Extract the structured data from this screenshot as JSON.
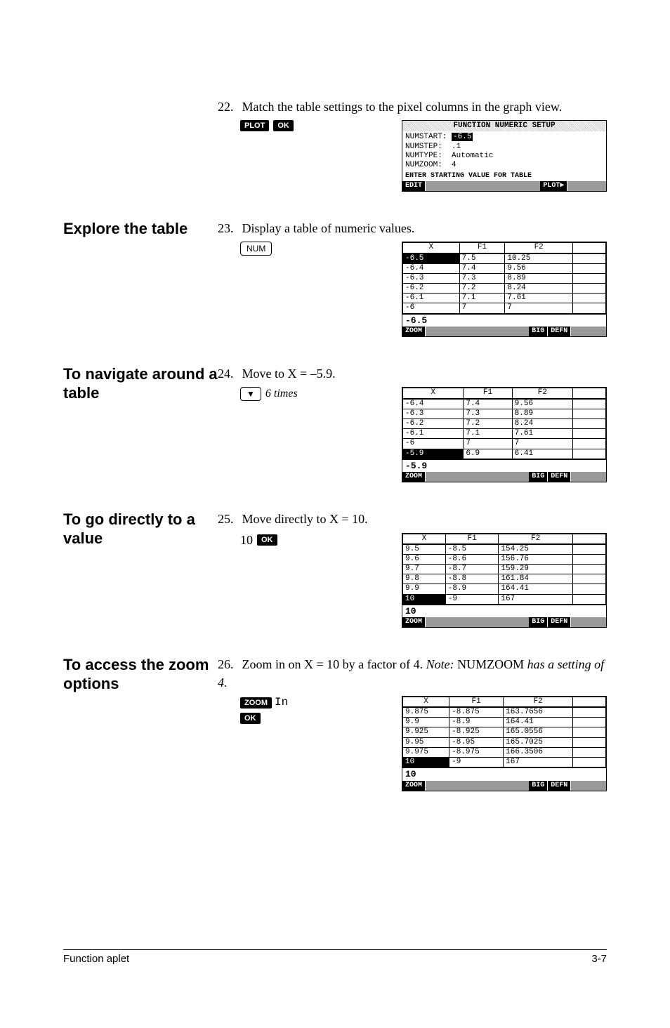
{
  "step22": {
    "num": "22.",
    "text": "Match the table settings to the pixel columns in the graph view.",
    "keys": {
      "plot": "PLOT",
      "ok": "OK"
    }
  },
  "setup_screen": {
    "title": "FUNCTION NUMERIC SETUP",
    "numstart": {
      "label": "NUMSTART:",
      "value": "-6.5"
    },
    "numstep": {
      "label": "NUMSTEP:",
      "value": ".1"
    },
    "numtype": {
      "label": "NUMTYPE:",
      "value": "Automatic"
    },
    "numzoom": {
      "label": "NUMZOOM:",
      "value": "4"
    },
    "prompt": "ENTER STARTING VALUE FOR TABLE",
    "foot": [
      "EDIT",
      "",
      "",
      "",
      "PLOT▶",
      ""
    ]
  },
  "explore": {
    "heading": "Explore the table",
    "num": "23.",
    "text": "Display a table of numeric values.",
    "key": "NUM"
  },
  "table23": {
    "head": [
      "X",
      "F1",
      "F2"
    ],
    "rows": [
      [
        "-6.5",
        "7.5",
        "10.25"
      ],
      [
        "-6.4",
        "7.4",
        "9.56"
      ],
      [
        "-6.3",
        "7.3",
        "8.89"
      ],
      [
        "-6.2",
        "7.2",
        "8.24"
      ],
      [
        "-6.1",
        "7.1",
        "7.61"
      ],
      [
        "-6",
        "7",
        "7"
      ]
    ],
    "sel_row": 0,
    "input": "-6.5",
    "foot": [
      "ZOOM",
      "",
      "",
      "BIG",
      "DEFN",
      ""
    ]
  },
  "navigate": {
    "heading": "To navigate around a table",
    "num": "24.",
    "text": "Move to X = –5.9.",
    "key": "▼",
    "times": "6 times"
  },
  "table24": {
    "head": [
      "X",
      "F1",
      "F2"
    ],
    "rows": [
      [
        "-6.4",
        "7.4",
        "9.56"
      ],
      [
        "-6.3",
        "7.3",
        "8.89"
      ],
      [
        "-6.2",
        "7.2",
        "8.24"
      ],
      [
        "-6.1",
        "7.1",
        "7.61"
      ],
      [
        "-6",
        "7",
        "7"
      ],
      [
        "-5.9",
        "6.9",
        "6.41"
      ]
    ],
    "sel_row": 5,
    "input": "-5.9",
    "foot": [
      "ZOOM",
      "",
      "",
      "BIG",
      "DEFN",
      ""
    ]
  },
  "direct": {
    "heading": "To go directly to a value",
    "num": "25.",
    "text": "Move directly to X = 10.",
    "entry": "10",
    "ok": "OK"
  },
  "table25": {
    "head": [
      "X",
      "F1",
      "F2"
    ],
    "rows": [
      [
        "9.5",
        "-8.5",
        "154.25"
      ],
      [
        "9.6",
        "-8.6",
        "156.76"
      ],
      [
        "9.7",
        "-8.7",
        "159.29"
      ],
      [
        "9.8",
        "-8.8",
        "161.84"
      ],
      [
        "9.9",
        "-8.9",
        "164.41"
      ],
      [
        "10",
        "-9",
        "167"
      ]
    ],
    "sel_row": 5,
    "input": "10",
    "foot": [
      "ZOOM",
      "",
      "",
      "BIG",
      "DEFN",
      ""
    ]
  },
  "zoom": {
    "heading": "To access the zoom options",
    "num": "26.",
    "text_a": "Zoom in on X = 10 by a factor of 4. ",
    "note_label": "Note:",
    "note_text": " NUMZOOM ",
    "note_tail": "has a setting of 4.",
    "zoom_key": "ZOOM",
    "in_text": "In",
    "ok": "OK"
  },
  "table26": {
    "head": [
      "X",
      "F1",
      "F2"
    ],
    "rows": [
      [
        "9.875",
        "-8.875",
        "163.7656"
      ],
      [
        "9.9",
        "-8.9",
        "164.41"
      ],
      [
        "9.925",
        "-8.925",
        "165.0556"
      ],
      [
        "9.95",
        "-8.95",
        "165.7025"
      ],
      [
        "9.975",
        "-8.975",
        "166.3506"
      ],
      [
        "10",
        "-9",
        "167"
      ]
    ],
    "sel_row": 5,
    "input": "10",
    "foot": [
      "ZOOM",
      "",
      "",
      "BIG",
      "DEFN",
      ""
    ]
  },
  "footer": {
    "left": "Function aplet",
    "right": "3-7"
  }
}
